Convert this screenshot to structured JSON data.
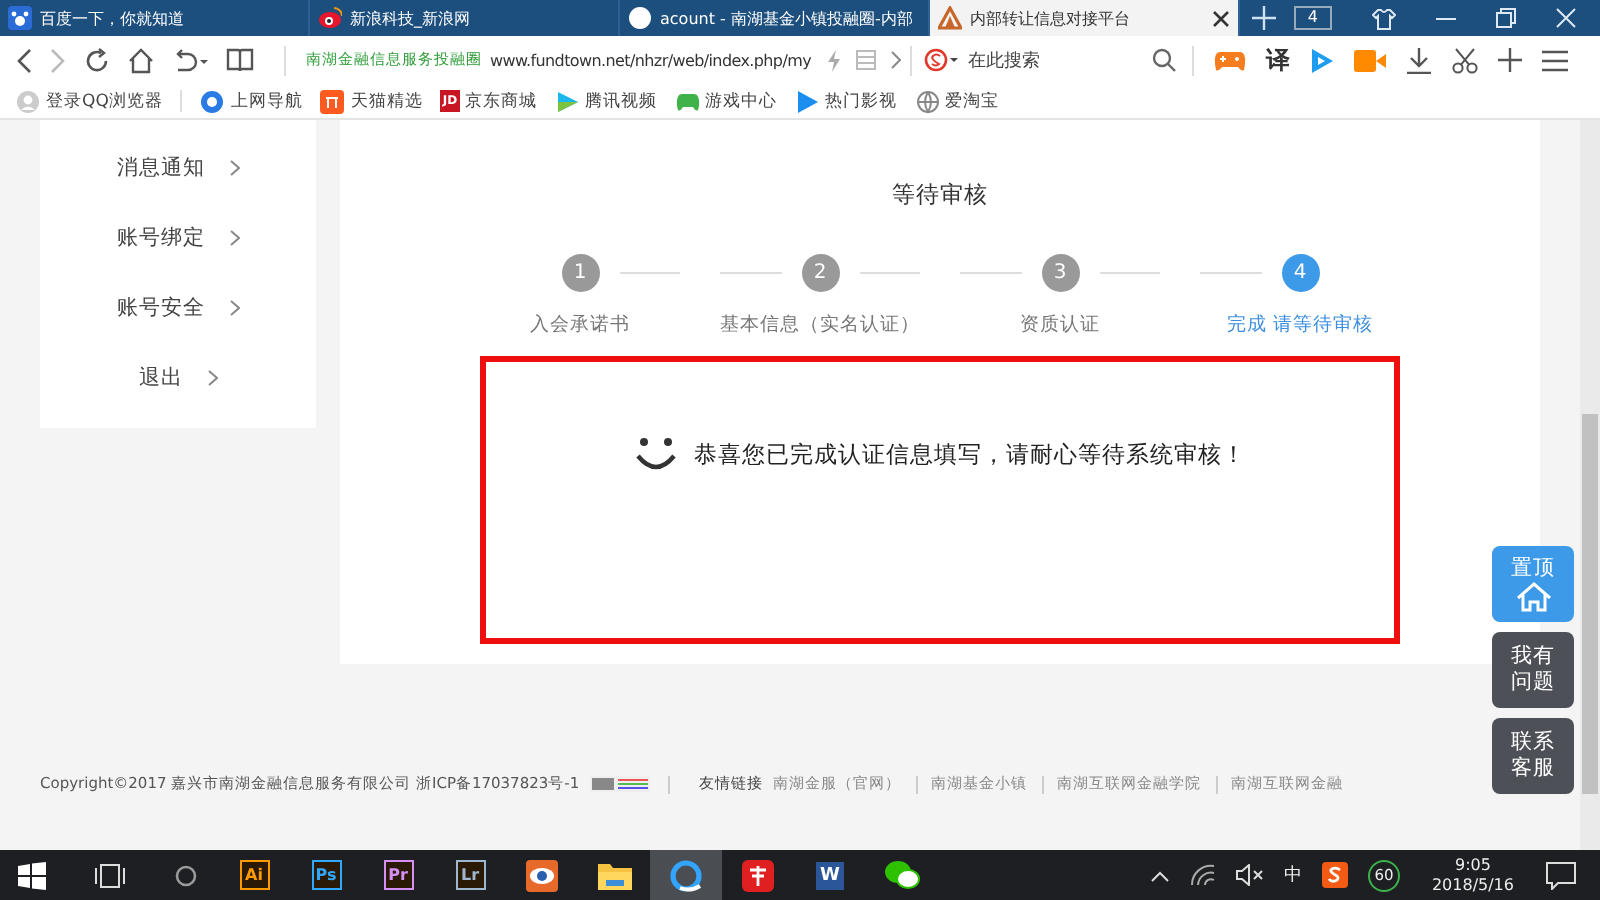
{
  "browser": {
    "tabs": [
      {
        "title": "百度一下，你就知道",
        "kind": "baidu",
        "selected": false
      },
      {
        "title": "新浪科技_新浪网",
        "kind": "weibo",
        "selected": false
      },
      {
        "title": "acount - 南湖基金小镇投融圈-内部",
        "kind": "circle",
        "selected": false
      },
      {
        "title": "内部转让信息对接平台",
        "kind": "triangle",
        "selected": true
      }
    ],
    "tab_count": "4",
    "address": {
      "site_name": "南湖金融信息服务投融圈",
      "url": "www.fundtown.net/nhzr/web/index.php/my"
    },
    "search": {
      "placeholder": "在此搜索"
    },
    "translate_button": "译",
    "bookmarks": [
      {
        "label": "登录QQ浏览器",
        "kind": "user"
      },
      {
        "label": "上网导航",
        "kind": "nav"
      },
      {
        "label": "天猫精选",
        "kind": "tmall"
      },
      {
        "label": "京东商城",
        "kind": "jd",
        "badge": "JD"
      },
      {
        "label": "腾讯视频",
        "kind": "video"
      },
      {
        "label": "游戏中心",
        "kind": "game"
      },
      {
        "label": "热门影视",
        "kind": "play"
      },
      {
        "label": "爱淘宝",
        "kind": "globe"
      }
    ]
  },
  "sidebar": {
    "items": [
      {
        "label": "消息通知"
      },
      {
        "label": "账号绑定"
      },
      {
        "label": "账号安全"
      },
      {
        "label": "退出"
      }
    ]
  },
  "page": {
    "title": "等待审核",
    "steps": [
      {
        "number": "1",
        "label": "入会承诺书",
        "selected": false
      },
      {
        "number": "2",
        "label": "基本信息（实名认证）",
        "selected": false
      },
      {
        "number": "3",
        "label": "资质认证",
        "selected": false
      },
      {
        "number": "4",
        "label": "完成 请等待审核",
        "selected": true
      }
    ],
    "message": "恭喜您已完成认证信息填写，请耐心等待系统审核！"
  },
  "footer": {
    "copyright": "Copyright©2017 嘉兴市南湖金融信息服务有限公司 浙ICP备17037823号-1",
    "links_label": "友情链接",
    "links": [
      "南湖金服（官网）",
      "南湖基金小镇",
      "南湖互联网金融学院",
      "南湖互联网金融"
    ]
  },
  "float_buttons": [
    {
      "label": "置顶",
      "kind": "top"
    },
    {
      "label": "我有问题",
      "kind": "text"
    },
    {
      "label": "联系客服",
      "kind": "text"
    }
  ],
  "taskbar": {
    "apps": [
      {
        "kind": "logo",
        "label": "Ai",
        "color": "#ff9a00",
        "selected": false
      },
      {
        "kind": "logo",
        "label": "Ps",
        "color": "#31a8ff",
        "selected": false
      },
      {
        "kind": "logo",
        "label": "Pr",
        "color": "#d58ff5",
        "selected": false
      },
      {
        "kind": "logo",
        "label": "Lr",
        "color": "#9fb6d1",
        "selected": false
      },
      {
        "kind": "eye",
        "selected": false
      },
      {
        "kind": "folder",
        "selected": false
      },
      {
        "kind": "browser",
        "selected": true
      },
      {
        "kind": "red",
        "selected": false
      },
      {
        "kind": "word",
        "label": "W",
        "selected": false
      },
      {
        "kind": "chat",
        "selected": false
      }
    ],
    "tray": {
      "ime": "中",
      "score": "60",
      "time": "9:05",
      "date": "2018/5/16"
    }
  }
}
